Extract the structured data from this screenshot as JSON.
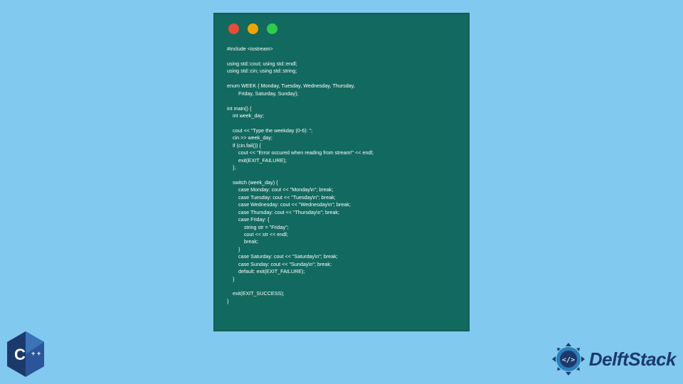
{
  "code_window": {
    "traffic_lights": {
      "red": "#e94b35",
      "yellow": "#f1a400",
      "green": "#2fcc4a"
    },
    "code": "#include <iostream>\n\nusing std::cout; using std::endl;\nusing std::cin; using std::string;\n\nenum WEEK { Monday, Tuesday, Wednesday, Thursday,\n        Friday, Saturday, Sunday};\n\nint main() {\n    int week_day;\n\n    cout << \"Type the weekday (0-6): \";\n    cin >> week_day;\n    if (cin.fail()) {\n        cout << \"Error occured when reading from stream!\" << endl;\n        exit(EXIT_FAILURE);\n    };\n\n    switch (week_day) {\n        case Monday: cout << \"Monday\\n\"; break;\n        case Tuesday: cout << \"Tuesday\\n\"; break;\n        case Wednesday: cout << \"Wednesday\\n\"; break;\n        case Thursday: cout << \"Thursday\\n\"; break;\n        case Friday: {\n            string str = \"Friday\";\n            cout << str << endl;\n            break;\n        }\n        case Saturday: cout << \"Saturday\\n\"; break;\n        case Sunday: cout << \"Sunday\\n\"; break;\n        default: exit(EXIT_FAILURE);\n    }\n\n    exit(EXIT_SUCCESS);\n}"
  },
  "logos": {
    "cpp_label": "C++",
    "delft_label": "DelftStack"
  }
}
